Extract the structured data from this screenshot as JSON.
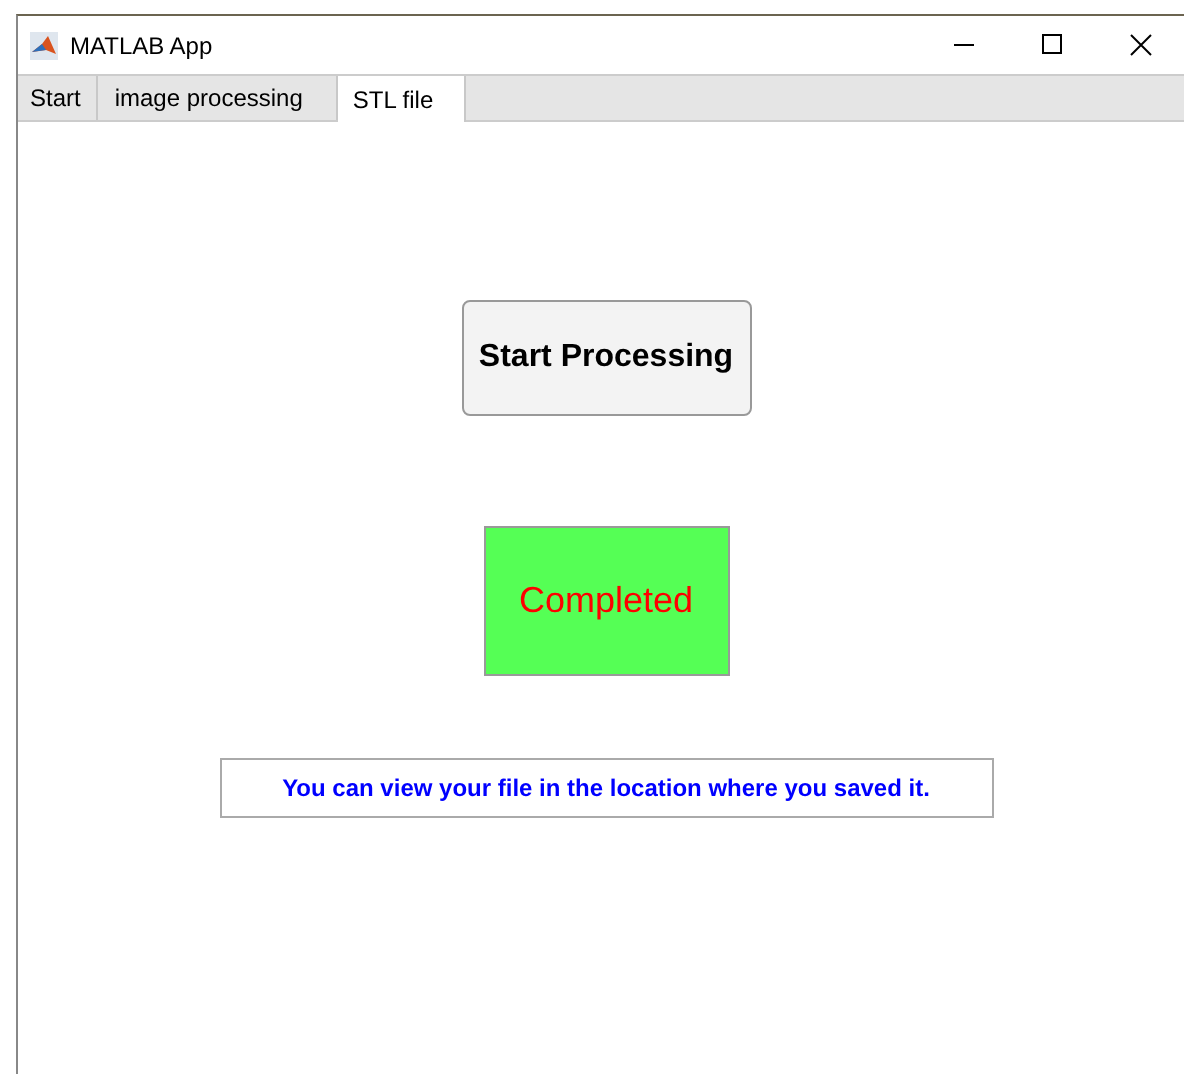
{
  "window": {
    "title": "MATLAB App"
  },
  "tabs": [
    {
      "label": "Start",
      "selected": false
    },
    {
      "label": "image processing",
      "selected": false
    },
    {
      "label": "STL file",
      "selected": true
    }
  ],
  "start_button": {
    "label": "Start Processing"
  },
  "status": {
    "text": "Completed"
  },
  "message": {
    "text": "You can view your file in the location where you saved it."
  }
}
